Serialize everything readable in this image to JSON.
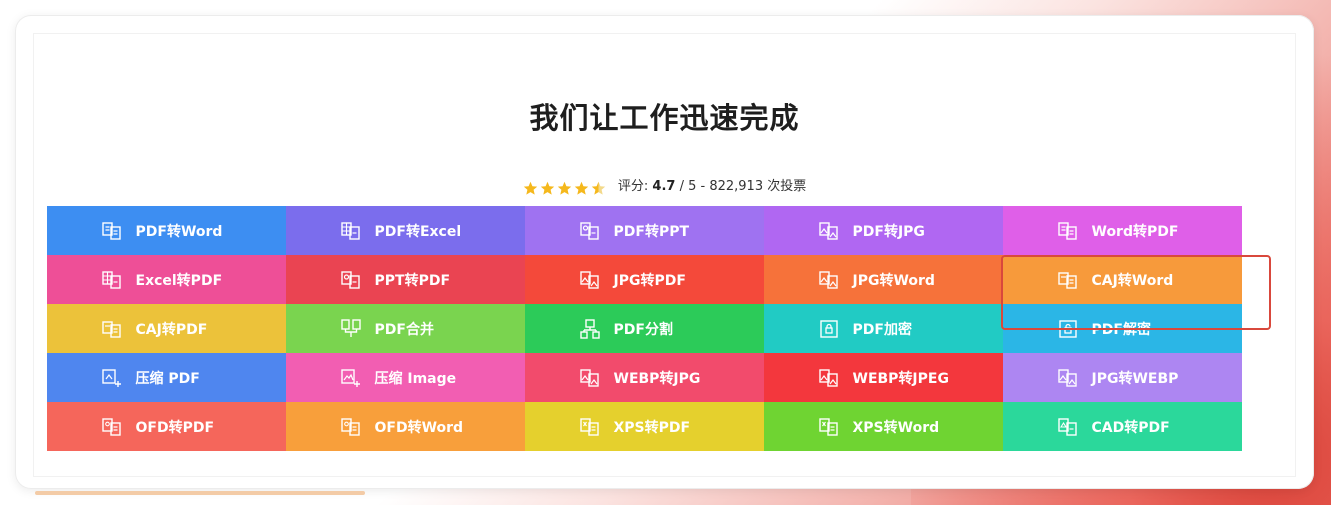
{
  "page": {
    "title": "我们让工作迅速完成",
    "rating": {
      "label": "评分:",
      "score": "4.7",
      "suffix": "/ 5 - 822,913 次投票",
      "stars_value": 4.5,
      "stars_max": 5,
      "star_color": "#f5b81c"
    }
  },
  "tools": [
    {
      "label": "PDF转Word",
      "color": "#3d8ef2",
      "icon": "doc-convert-icon"
    },
    {
      "label": "PDF转Excel",
      "color": "#7b6ded",
      "icon": "table-convert-icon"
    },
    {
      "label": "PDF转PPT",
      "color": "#9f72f1",
      "icon": "slides-convert-icon"
    },
    {
      "label": "PDF转JPG",
      "color": "#b067f2",
      "icon": "image-convert-icon"
    },
    {
      "label": "Word转PDF",
      "color": "#df5fe8",
      "icon": "doc-convert-icon"
    },
    {
      "label": "Excel转PDF",
      "color": "#ee4f97",
      "icon": "table-convert-icon"
    },
    {
      "label": "PPT转PDF",
      "color": "#ea4452",
      "icon": "slides-convert-icon"
    },
    {
      "label": "JPG转PDF",
      "color": "#f4493a",
      "icon": "image-convert-icon"
    },
    {
      "label": "JPG转Word",
      "color": "#f6723a",
      "icon": "image-convert-icon"
    },
    {
      "label": "CAJ转Word",
      "color": "#f79a3b",
      "icon": "caj-convert-icon"
    },
    {
      "label": "CAJ转PDF",
      "color": "#ecc23a",
      "icon": "caj-convert-icon"
    },
    {
      "label": "PDF合并",
      "color": "#7ad44f",
      "icon": "merge-icon"
    },
    {
      "label": "PDF分割",
      "color": "#2ccb59",
      "icon": "split-icon"
    },
    {
      "label": "PDF加密",
      "color": "#21cbc4",
      "icon": "lock-icon"
    },
    {
      "label": "PDF解密",
      "color": "#2bb6e6",
      "icon": "unlock-icon"
    },
    {
      "label": "压缩 PDF",
      "color": "#4f86ef",
      "icon": "compress-icon"
    },
    {
      "label": "压缩 Image",
      "color": "#f25eb2",
      "icon": "compress-image-icon"
    },
    {
      "label": "WEBP转JPG",
      "color": "#f24b6c",
      "icon": "image-convert-icon"
    },
    {
      "label": "WEBP转JPEG",
      "color": "#f3373d",
      "icon": "image-convert-icon"
    },
    {
      "label": "JPG转WEBP",
      "color": "#ad86f2",
      "icon": "image-convert-icon"
    },
    {
      "label": "OFD转PDF",
      "color": "#f5665b",
      "icon": "ofd-convert-icon"
    },
    {
      "label": "OFD转Word",
      "color": "#f89f3b",
      "icon": "ofd-convert-icon"
    },
    {
      "label": "XPS转PDF",
      "color": "#e5d02d",
      "icon": "xps-convert-icon"
    },
    {
      "label": "XPS转Word",
      "color": "#6fd432",
      "icon": "xps-convert-icon"
    },
    {
      "label": "CAD转PDF",
      "color": "#2bd89b",
      "icon": "cad-convert-icon"
    }
  ],
  "highlight_target": "CAJ转Word"
}
